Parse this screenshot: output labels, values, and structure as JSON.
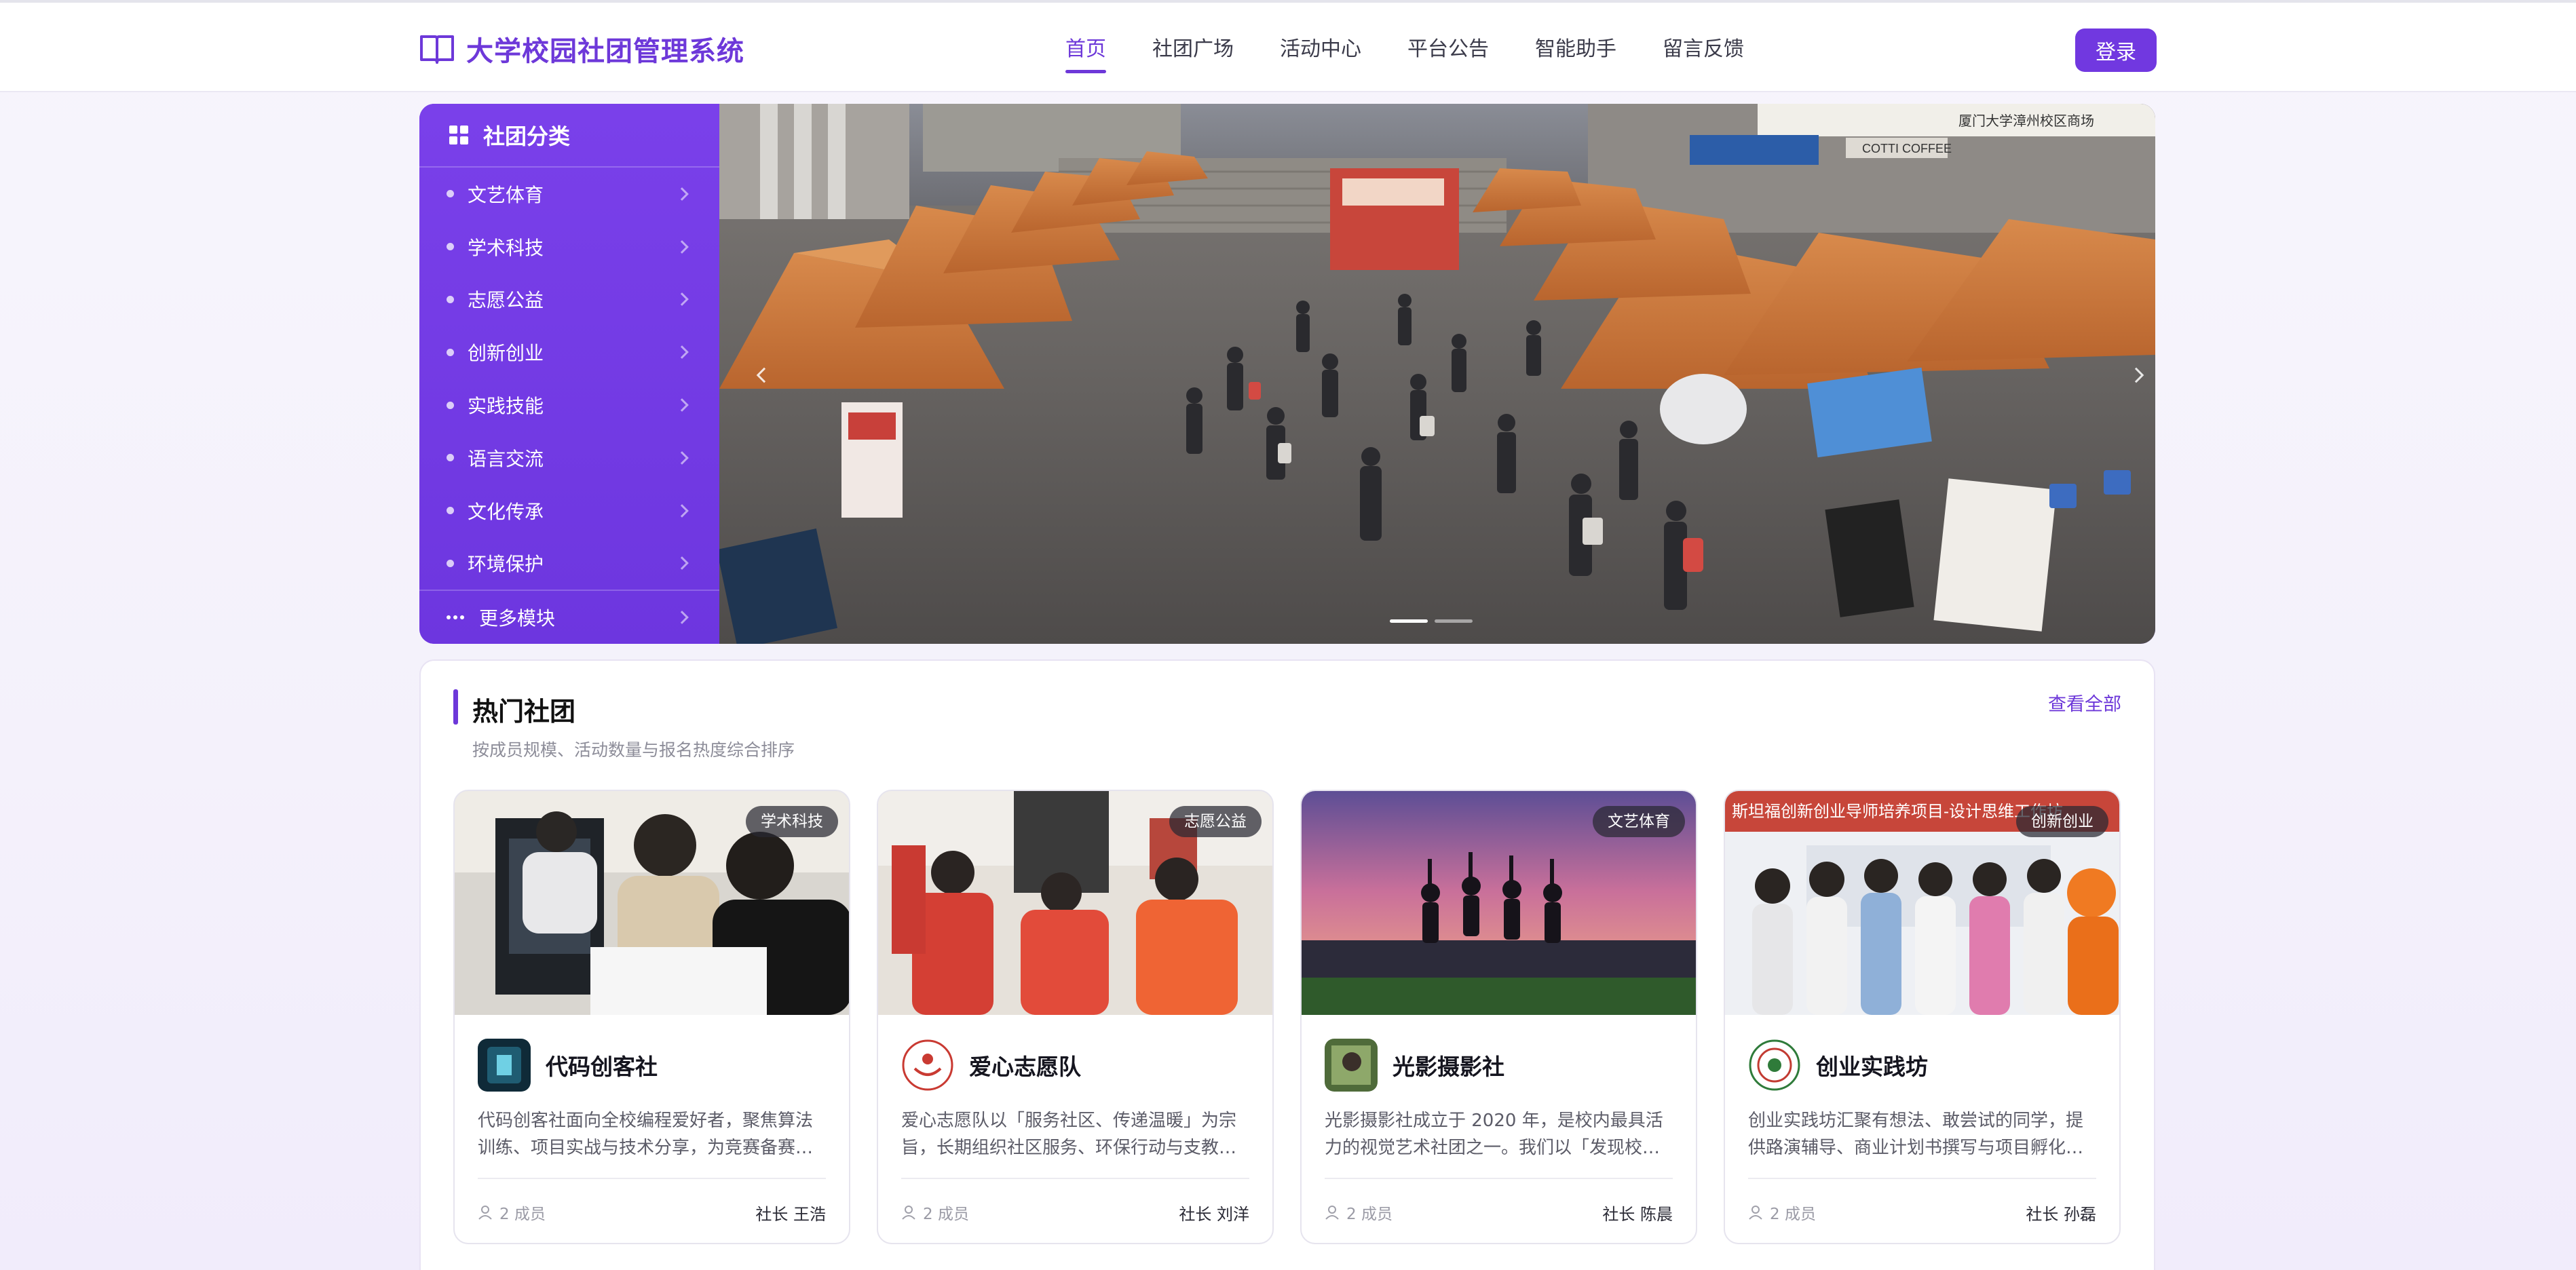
{
  "app": {
    "title": "大学校园社团管理系统",
    "brand_color": "#6d38d9"
  },
  "nav": {
    "items": [
      {
        "label": "首页",
        "active": true
      },
      {
        "label": "社团广场",
        "active": false
      },
      {
        "label": "活动中心",
        "active": false
      },
      {
        "label": "平台公告",
        "active": false
      },
      {
        "label": "智能助手",
        "active": false
      },
      {
        "label": "留言反馈",
        "active": false
      }
    ],
    "login_label": "登录"
  },
  "sidebar": {
    "title": "社团分类",
    "icon": "grid-icon",
    "items": [
      {
        "label": "文艺体育"
      },
      {
        "label": "学术科技"
      },
      {
        "label": "志愿公益"
      },
      {
        "label": "创新创业"
      },
      {
        "label": "实践技能"
      },
      {
        "label": "语言交流"
      },
      {
        "label": "文化传承"
      },
      {
        "label": "环境保护"
      }
    ],
    "more_label": "更多模块"
  },
  "banner": {
    "image": "campus club fair photo",
    "slides": 2,
    "active_slide": 1,
    "storefront_sign": "厦门大学漳州校区商场",
    "cafe_sign": "COTTI COFFEE"
  },
  "hot_clubs": {
    "title": "热门社团",
    "subtitle": "按成员规模、活动数量与报名热度综合排序",
    "view_all": "查看全部",
    "cards": [
      {
        "tag": "学术科技",
        "name": "代码创客社",
        "description": "代码创客社面向全校编程爱好者，聚焦算法训练、项目实战与技术分享，为竞赛备赛…",
        "members": "2 成员",
        "leader": "社长 王浩",
        "photo": "students at computer"
      },
      {
        "tag": "志愿公益",
        "name": "爱心志愿队",
        "description": "爱心志愿队以「服务社区、传递温暖」为宗旨，长期组织社区服务、环保行动与支教…",
        "members": "2 成员",
        "leader": "社长 刘洋",
        "photo": "volunteers in red vests"
      },
      {
        "tag": "文艺体育",
        "name": "光影摄影社",
        "description": "光影摄影社成立于 2020 年，是校内最具活力的视觉艺术社团之一。我们以「发现校…",
        "members": "2 成员",
        "leader": "社长 陈晨",
        "photo": "students jumping at sunset"
      },
      {
        "tag": "创新创业",
        "name": "创业实践坊",
        "description": "创业实践坊汇聚有想法、敢尝试的同学，提供路演辅导、商业计划书撰写与项目孵化…",
        "members": "2 成员",
        "leader": "社长 孙磊",
        "photo": "group photo at workshop",
        "banner_text": "斯坦福创新创业导师培养项目-设计思维工作坊"
      }
    ]
  }
}
